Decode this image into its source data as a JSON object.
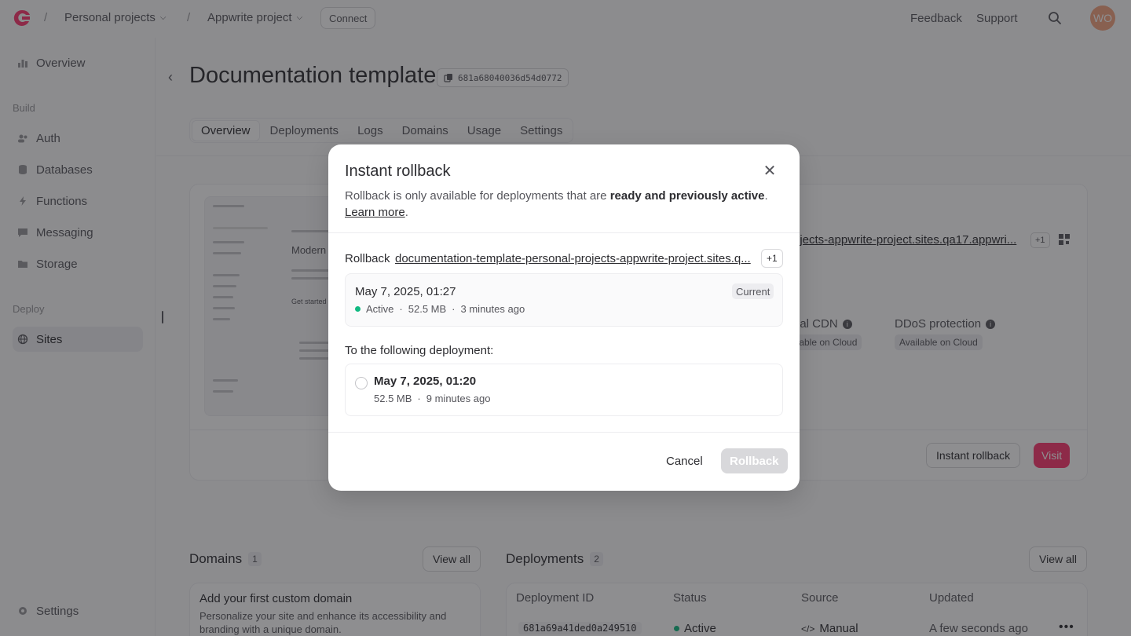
{
  "topbar": {
    "org_label": "Personal projects",
    "project_label": "Appwrite project",
    "connect_label": "Connect",
    "feedback_label": "Feedback",
    "support_label": "Support",
    "avatar_initials": "WO",
    "separator": "/"
  },
  "sidebar": {
    "overview": "Overview",
    "build_title": "Build",
    "auth": "Auth",
    "databases": "Databases",
    "functions": "Functions",
    "messaging": "Messaging",
    "storage": "Storage",
    "deploy_title": "Deploy",
    "sites": "Sites",
    "settings": "Settings"
  },
  "page": {
    "title": "Documentation template",
    "site_id": "681a68040036d54d0772",
    "tabs": [
      "Overview",
      "Deployments",
      "Logs",
      "Domains",
      "Usage",
      "Settings"
    ]
  },
  "site_card": {
    "url": "ojects-appwrite-project.sites.qa17.appwri...",
    "url_plus": "+1",
    "cdn_label": "bal CDN",
    "cdn_value": "llable on Cloud",
    "ddos_label": "DDoS protection",
    "ddos_value": "Available on Cloud",
    "instant_rollback_label": "Instant rollback",
    "visit_label": "Visit",
    "preview_heading": "Modern",
    "preview_sub": "Get started"
  },
  "domains": {
    "title": "Domains",
    "count": "1",
    "view_all": "View all",
    "empty_title": "Add your first custom domain",
    "empty_desc": "Personalize your site and enhance its accessibility and branding with a unique domain."
  },
  "deployments": {
    "title": "Deployments",
    "count": "2",
    "view_all": "View all",
    "columns": [
      "Deployment ID",
      "Status",
      "Source",
      "Updated"
    ],
    "rows": [
      {
        "id": "681a69a41ded0a249510",
        "status": "Active",
        "source": "Manual",
        "updated": "A few seconds ago"
      }
    ]
  },
  "modal": {
    "title": "Instant rollback",
    "desc_prefix": "Rollback is only available for deployments that are ",
    "desc_bold": "ready and previously active",
    "desc_suffix": ".",
    "learn_more": "Learn more",
    "learn_suffix": ".",
    "rollback_label": "Rollback",
    "rollback_url": "documentation-template-personal-projects-appwrite-project.sites.q...",
    "rollback_plus": "+1",
    "current": {
      "date": "May 7, 2025, 01:27",
      "tag": "Current",
      "status": "Active",
      "size": "52.5 MB",
      "ago": "3 minutes ago"
    },
    "following_label": "To the following deployment:",
    "option": {
      "date": "May 7, 2025, 01:20",
      "size": "52.5 MB",
      "ago": "9 minutes ago"
    },
    "cancel_label": "Cancel",
    "confirm_label": "Rollback",
    "separator": "·"
  },
  "colors": {
    "brand": "#fd366e",
    "active_green": "#10b981",
    "disabled_button": "#d8d8db"
  }
}
